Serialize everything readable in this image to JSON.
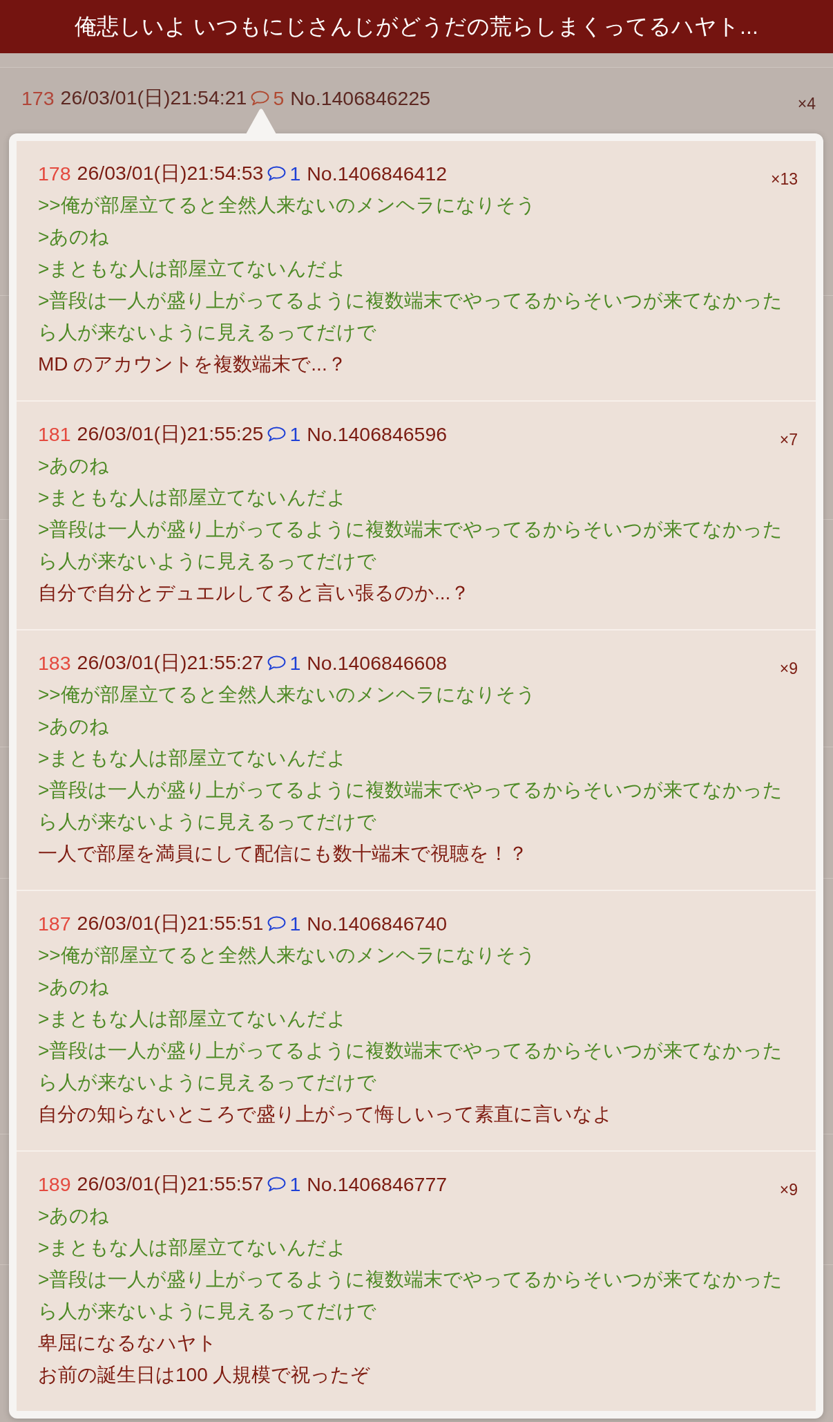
{
  "header": {
    "title": "俺悲しいよ いつもにじさんじがどうだの荒らしまくってるハヤト..."
  },
  "thread": {
    "posts": [
      {
        "number": "173",
        "date": "26/03/01(日)21:54:21",
        "replies": {
          "count": "5",
          "color": "#b04a32"
        },
        "post_no": "No.1406846225",
        "multiplier": "×4"
      }
    ]
  },
  "popup": {
    "posts": [
      {
        "number": "178",
        "date": "26/03/01(日)21:54:53",
        "replies": {
          "count": "1",
          "color": "#1e40d6"
        },
        "post_no": "No.1406846412",
        "multiplier": "×13",
        "lines": [
          {
            "kind": "quote",
            "text": ">>俺が部屋立てると全然人来ないのメンヘラになりそう"
          },
          {
            "kind": "quote",
            "text": ">あのね"
          },
          {
            "kind": "quote",
            "text": ">まともな人は部屋立てないんだよ"
          },
          {
            "kind": "quote",
            "text": ">普段は一人が盛り上がってるように複数端末でやってるからそいつが来てなかったら人が来ないように見えるってだけで"
          },
          {
            "kind": "text",
            "text": "MD のアカウントを複数端末で...？"
          }
        ]
      },
      {
        "number": "181",
        "date": "26/03/01(日)21:55:25",
        "replies": {
          "count": "1",
          "color": "#1e40d6"
        },
        "post_no": "No.1406846596",
        "multiplier": "×7",
        "lines": [
          {
            "kind": "quote",
            "text": ">あのね"
          },
          {
            "kind": "quote",
            "text": ">まともな人は部屋立てないんだよ"
          },
          {
            "kind": "quote",
            "text": ">普段は一人が盛り上がってるように複数端末でやってるからそいつが来てなかったら人が来ないように見えるってだけで"
          },
          {
            "kind": "text",
            "text": "自分で自分とデュエルしてると言い張るのか...？"
          }
        ]
      },
      {
        "number": "183",
        "date": "26/03/01(日)21:55:27",
        "replies": {
          "count": "1",
          "color": "#1e40d6"
        },
        "post_no": "No.1406846608",
        "multiplier": "×9",
        "lines": [
          {
            "kind": "quote",
            "text": ">>俺が部屋立てると全然人来ないのメンヘラになりそう"
          },
          {
            "kind": "quote",
            "text": ">あのね"
          },
          {
            "kind": "quote",
            "text": ">まともな人は部屋立てないんだよ"
          },
          {
            "kind": "quote",
            "text": ">普段は一人が盛り上がってるように複数端末でやってるからそいつが来てなかったら人が来ないように見えるってだけで"
          },
          {
            "kind": "text",
            "text": "一人で部屋を満員にして配信にも数十端末で視聴を！？"
          }
        ]
      },
      {
        "number": "187",
        "date": "26/03/01(日)21:55:51",
        "replies": {
          "count": "1",
          "color": "#1e40d6"
        },
        "post_no": "No.1406846740",
        "lines": [
          {
            "kind": "quote",
            "text": ">>俺が部屋立てると全然人来ないのメンヘラになりそう"
          },
          {
            "kind": "quote",
            "text": ">あのね"
          },
          {
            "kind": "quote",
            "text": ">まともな人は部屋立てないんだよ"
          },
          {
            "kind": "quote",
            "text": ">普段は一人が盛り上がってるように複数端末でやってるからそいつが来てなかったら人が来ないように見えるってだけで"
          },
          {
            "kind": "text",
            "text": "自分の知らないところで盛り上がって悔しいって素直に言いなよ"
          }
        ]
      },
      {
        "number": "189",
        "date": "26/03/01(日)21:55:57",
        "replies": {
          "count": "1",
          "color": "#1e40d6"
        },
        "post_no": "No.1406846777",
        "multiplier": "×9",
        "lines": [
          {
            "kind": "quote",
            "text": ">あのね"
          },
          {
            "kind": "quote",
            "text": ">まともな人は部屋立てないんだよ"
          },
          {
            "kind": "quote",
            "text": ">普段は一人が盛り上がってるように複数端末でやってるからそいつが来てなかったら人が来ないように見えるってだけで"
          },
          {
            "kind": "text",
            "text": "卑屈になるなハヤト"
          },
          {
            "kind": "text",
            "text": "お前の誕生日は100 人規模で祝ったぞ"
          }
        ]
      }
    ]
  }
}
